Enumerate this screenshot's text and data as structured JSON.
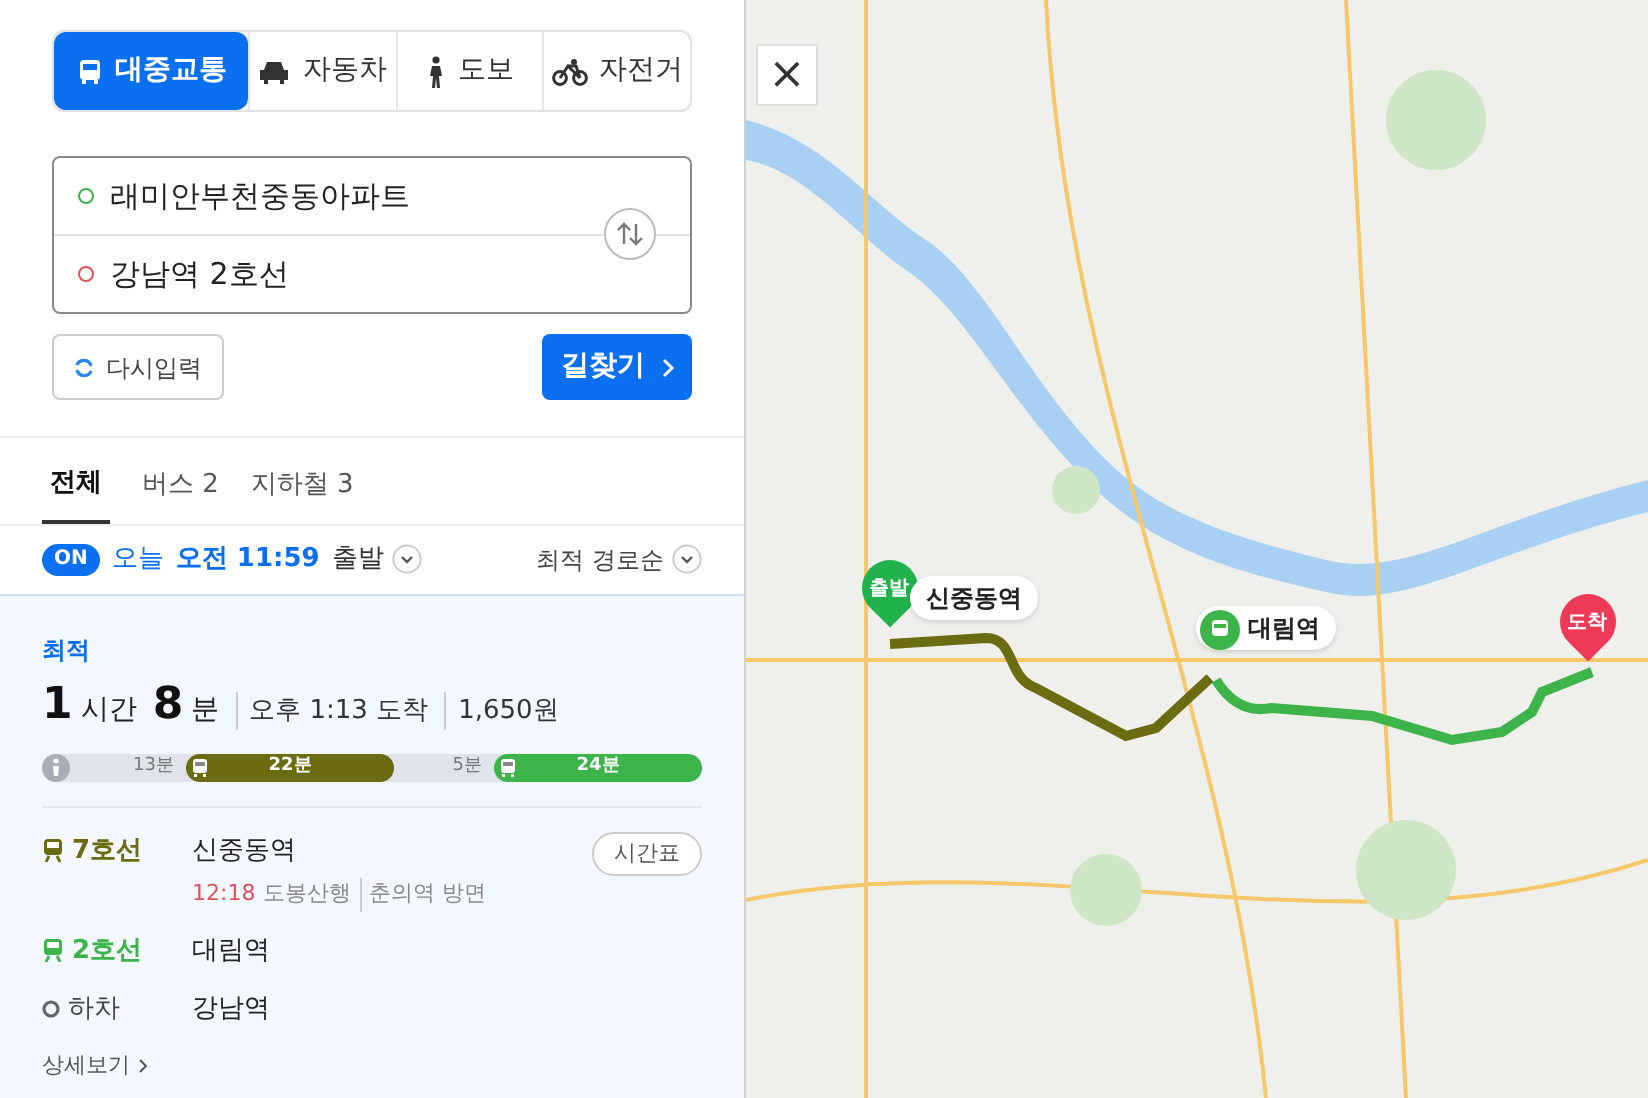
{
  "modes": [
    {
      "kind": "transit",
      "label": "대중교통",
      "selected": true
    },
    {
      "kind": "car",
      "label": "자동차",
      "selected": false
    },
    {
      "kind": "walk",
      "label": "도보",
      "selected": false
    },
    {
      "kind": "bike",
      "label": "자전거",
      "selected": false
    }
  ],
  "origin": {
    "value": "래미안부천중동아파트"
  },
  "destination": {
    "value": "강남역 2호선"
  },
  "reset_button": "다시입력",
  "search_button": "길찾기",
  "result_tabs": [
    {
      "label": "전체",
      "selected": true
    },
    {
      "label": "버스 2",
      "selected": false
    },
    {
      "label": "지하철 3",
      "selected": false
    }
  ],
  "departure": {
    "badge": "ON",
    "day": "오늘",
    "time": "오전 11:59",
    "suffix": "출발"
  },
  "sort": "최적 경로순",
  "route": {
    "tag": "최적",
    "hours": "1",
    "hours_unit": "시간",
    "minutes": "8",
    "minutes_unit": "분",
    "arrival": "오후 1:13 도착",
    "fare": "1,650원",
    "segments": [
      {
        "kind": "walk",
        "label": "13분"
      },
      {
        "kind": "subway",
        "label": "22분",
        "color": "#6b6b12"
      },
      {
        "kind": "walk",
        "label": "5분"
      },
      {
        "kind": "subway",
        "label": "24분",
        "color": "#3cb44a"
      }
    ],
    "steps": [
      {
        "kind": "line",
        "line": "7호선",
        "color": "#6b6b12",
        "station": "신중동역",
        "time": "12:18",
        "direction": "도봉산행",
        "toward": "춘의역 방면",
        "button": "시간표"
      },
      {
        "kind": "line",
        "line": "2호선",
        "color": "#3cb44a",
        "station": "대림역"
      },
      {
        "kind": "alight",
        "line": "하차",
        "station": "강남역"
      }
    ],
    "details": "상세보기"
  },
  "map": {
    "close": "×",
    "start_pin": "출발",
    "start_station": "신중동역",
    "transfer_station": "대림역",
    "end_pin": "도착"
  }
}
